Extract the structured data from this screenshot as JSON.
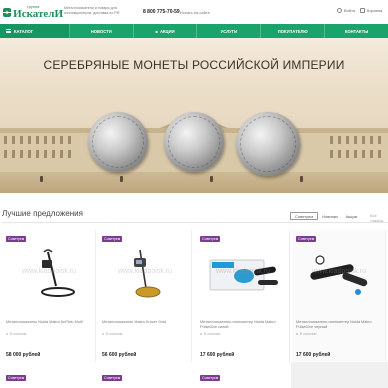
{
  "header": {
    "logo_small": "группа",
    "logo_big": "ИскателИ",
    "tagline": "Металлоискатели и товары для коллекционеров, доставка по РФ",
    "phone": "8 800 775-70-59",
    "search_placeholder": "Искать на сайте",
    "links": [
      {
        "label": "Войти",
        "icon": "user-icon"
      },
      {
        "label": "Корзина",
        "icon": "cart-icon"
      }
    ]
  },
  "nav": {
    "items": [
      {
        "label": "Каталог",
        "icon": "menu-icon"
      },
      {
        "label": "Новости"
      },
      {
        "label": "Акции",
        "icon": "gift-icon"
      },
      {
        "label": "Услуги"
      },
      {
        "label": "Покупателю"
      },
      {
        "label": "Контакты"
      }
    ]
  },
  "banner": {
    "title": "СЕРЕБРЯНЫЕ МОНЕТЫ РОССИЙСКОЙ ИМПЕРИИ"
  },
  "section": {
    "title": "Лучшие предложения",
    "filters": [
      "Советуем",
      "Новинки",
      "Акция"
    ],
    "active_filter": "Советуем",
    "see_all": "Все товары"
  },
  "products": [
    {
      "badge": "Советуем",
      "name": "Металлоискатель Nokta Makro AnFibio Multi",
      "stock": "В наличии",
      "price": "58 000 рублей",
      "watermark": "www.kladpoisk.ru"
    },
    {
      "badge": "Советуем",
      "name": "Металлоискатель Makro Kruzer Gold",
      "stock": "В наличии",
      "price": "56 600 рублей",
      "watermark": "www.kladpoisk.ru"
    },
    {
      "badge": "Советуем",
      "name": "Металлоискатель-пинпоинтер Nokta Makro PulseDive синий",
      "stock": "В наличии",
      "price": "17 600 рублей",
      "watermark": "www.kladpoisk.ru"
    },
    {
      "badge": "Советуем",
      "name": "Металлоискатель-пинпоинтер Nokta Makro PulseDive черный",
      "stock": "В наличии",
      "price": "17 600 рублей",
      "watermark": "www.kladpoisk.ru"
    }
  ],
  "row2_badges": [
    "Советуем",
    "Советуем",
    "Советуем"
  ],
  "colors": {
    "brand_green": "#1aa46c",
    "badge_purple": "#7b3b8e"
  }
}
